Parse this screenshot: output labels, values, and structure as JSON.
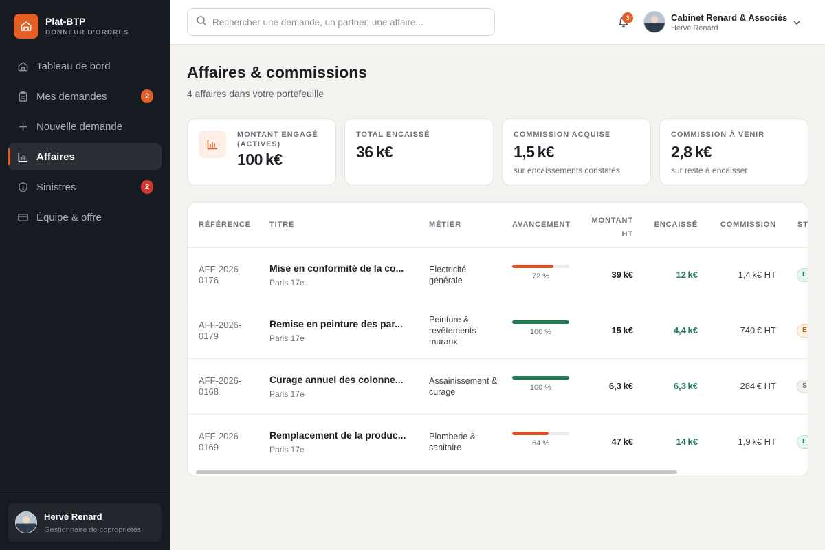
{
  "brand": {
    "name": "Plat-BTP",
    "subtitle": "DONNEUR D'ORDRES",
    "icon": "building-icon",
    "accent": "#e35d25"
  },
  "sidebar": {
    "items": [
      {
        "label": "Tableau de bord",
        "icon": "home-icon",
        "active": false,
        "badge": ""
      },
      {
        "label": "Mes demandes",
        "icon": "clipboard-icon",
        "active": false,
        "badge": "2"
      },
      {
        "label": "Nouvelle demande",
        "icon": "plus-icon",
        "active": false,
        "badge": ""
      },
      {
        "label": "Affaires",
        "icon": "bar-chart-icon",
        "active": true,
        "badge": ""
      },
      {
        "label": "Sinistres",
        "icon": "shield-icon",
        "active": false,
        "badge": "2"
      },
      {
        "label": "Équipe & offre",
        "icon": "card-icon",
        "active": false,
        "badge": ""
      }
    ],
    "user": {
      "name": "Hervé Renard",
      "role": "Gestionnaire de copropriétés"
    }
  },
  "topbar": {
    "search_placeholder": "Rechercher une demande, un partner, une affaire...",
    "notifications_count": "3",
    "account_name": "Cabinet Renard & Associés",
    "account_user": "Hervé Renard"
  },
  "page": {
    "title": "Affaires & commissions",
    "subtitle": "4 affaires dans votre portefeuille"
  },
  "stats": [
    {
      "label": "MONTANT ENGAGÉ (ACTIVES)",
      "value": "100 k€",
      "note": ""
    },
    {
      "label": "TOTAL ENCAISSÉ",
      "value": "36 k€",
      "note": ""
    },
    {
      "label": "COMMISSION ACQUISE",
      "value": "1,5 k€",
      "note": "sur encaissements constatés"
    },
    {
      "label": "COMMISSION À VENIR",
      "value": "2,8 k€",
      "note": "sur reste à encaisser"
    }
  ],
  "table": {
    "headers": {
      "reference": "RÉFÉRENCE",
      "titre": "TITRE",
      "metier": "MÉTIER",
      "avancement": "AVANCEMENT",
      "montant_1": "MONTANT",
      "montant_2": "HT",
      "encaisse": "ENCAISSÉ",
      "commission": "COMMISSION",
      "statut": "ST"
    },
    "rows": [
      {
        "ref_1": "AFF-2026-",
        "ref_2": "0176",
        "title": "Mise en conformité de la co...",
        "location": "Paris 17e",
        "metier": "Électricité générale",
        "progress": 72,
        "progress_label": "72 %",
        "progress_color": "#d9502a",
        "montant": "39 k€",
        "encaisse": "12 k€",
        "commission": "1,4 k€ HT",
        "status": "E",
        "status_color": "green"
      },
      {
        "ref_1": "AFF-2026-",
        "ref_2": "0179",
        "title": "Remise en peinture des par...",
        "location": "Paris 17e",
        "metier": "Peinture & revêtements muraux",
        "progress": 100,
        "progress_label": "100 %",
        "progress_color": "#1f7a52",
        "montant": "15 k€",
        "encaisse": "4,4 k€",
        "commission": "740 € HT",
        "status": "E",
        "status_color": "orange"
      },
      {
        "ref_1": "AFF-2026-",
        "ref_2": "0168",
        "title": "Curage annuel des colonne...",
        "location": "Paris 17e",
        "metier": "Assainissement & curage",
        "progress": 100,
        "progress_label": "100 %",
        "progress_color": "#1f7a52",
        "montant": "6,3 k€",
        "encaisse": "6,3 k€",
        "commission": "284 € HT",
        "status": "S",
        "status_color": "grey"
      },
      {
        "ref_1": "AFF-2026-",
        "ref_2": "0169",
        "title": "Remplacement de la produc...",
        "location": "Paris 17e",
        "metier": "Plomberie & sanitaire",
        "progress": 64,
        "progress_label": "64 %",
        "progress_color": "#d9502a",
        "montant": "47 k€",
        "encaisse": "14 k€",
        "commission": "1,9 k€ HT",
        "status": "E",
        "status_color": "green"
      }
    ]
  }
}
